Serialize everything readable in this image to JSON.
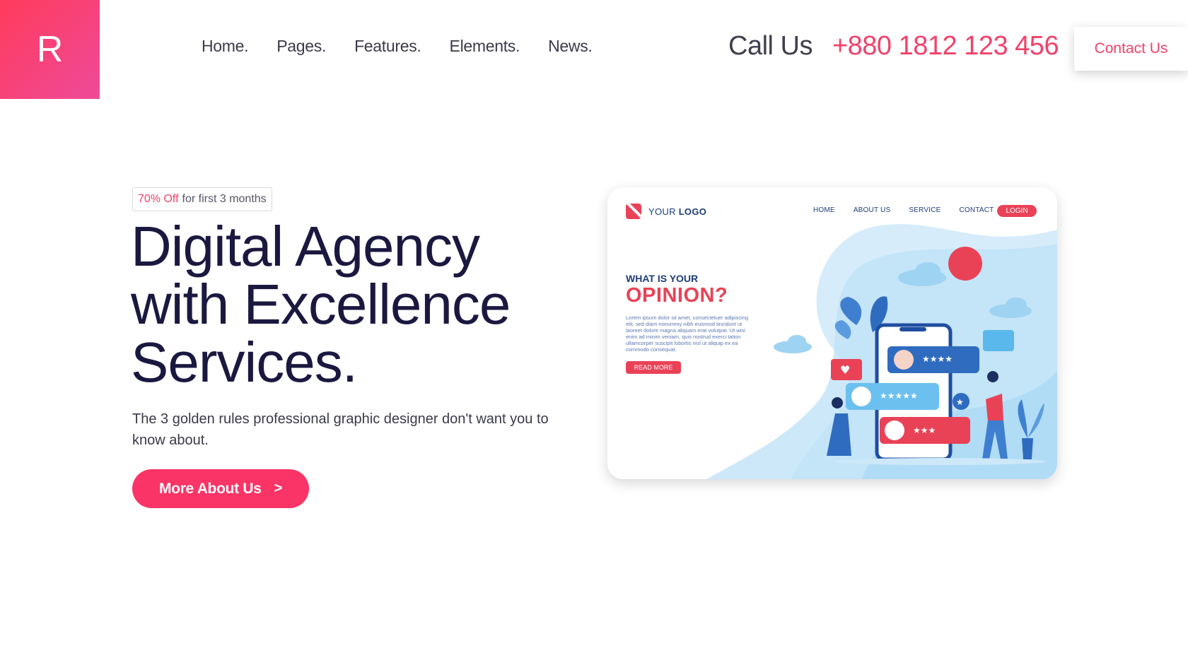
{
  "brand": {
    "logo_letter": "R"
  },
  "nav": {
    "items": [
      {
        "label": "Home."
      },
      {
        "label": "Pages."
      },
      {
        "label": "Features."
      },
      {
        "label": "Elements."
      },
      {
        "label": "News."
      }
    ]
  },
  "header": {
    "call_label": "Call Us",
    "call_number": "+880 1812 123 456",
    "contact_button": "Contact Us"
  },
  "hero": {
    "badge_accent": "70% Off",
    "badge_rest": "for first 3 months",
    "title_lines": [
      "Digital Agency",
      "with Excellence",
      "Services."
    ],
    "subtitle": "The 3 golden rules professional graphic designer don't want you to know about.",
    "cta_label": "More About Us",
    "cta_icon": ">"
  },
  "preview": {
    "logo_text_thin": "YOUR",
    "logo_text_bold": "LOGO",
    "nav": [
      "HOME",
      "ABOUT US",
      "SERVICE",
      "CONTACT"
    ],
    "login": "LOGIN",
    "what": "WHAT IS YOUR",
    "opinion": "OPINION?",
    "lorem": "Lorem ipsum dolor sit amet, consectetuer adipiscing elit, sed diam nonummy nibh euismod tincidunt ut laoreet dolore magna aliquam erat volutpat. Ut wisi enim ad minim veniam, quis nostrud exerci tation ullamcorper suscipit lobortis nisl ut aliquip ex ea commodo consequat.",
    "read_more": "READ MORE"
  },
  "colors": {
    "accent": "#f0426b",
    "cta": "#fa3466",
    "title": "#1b1840",
    "preview_blue": "#1e3d7a",
    "preview_red": "#e94257"
  }
}
